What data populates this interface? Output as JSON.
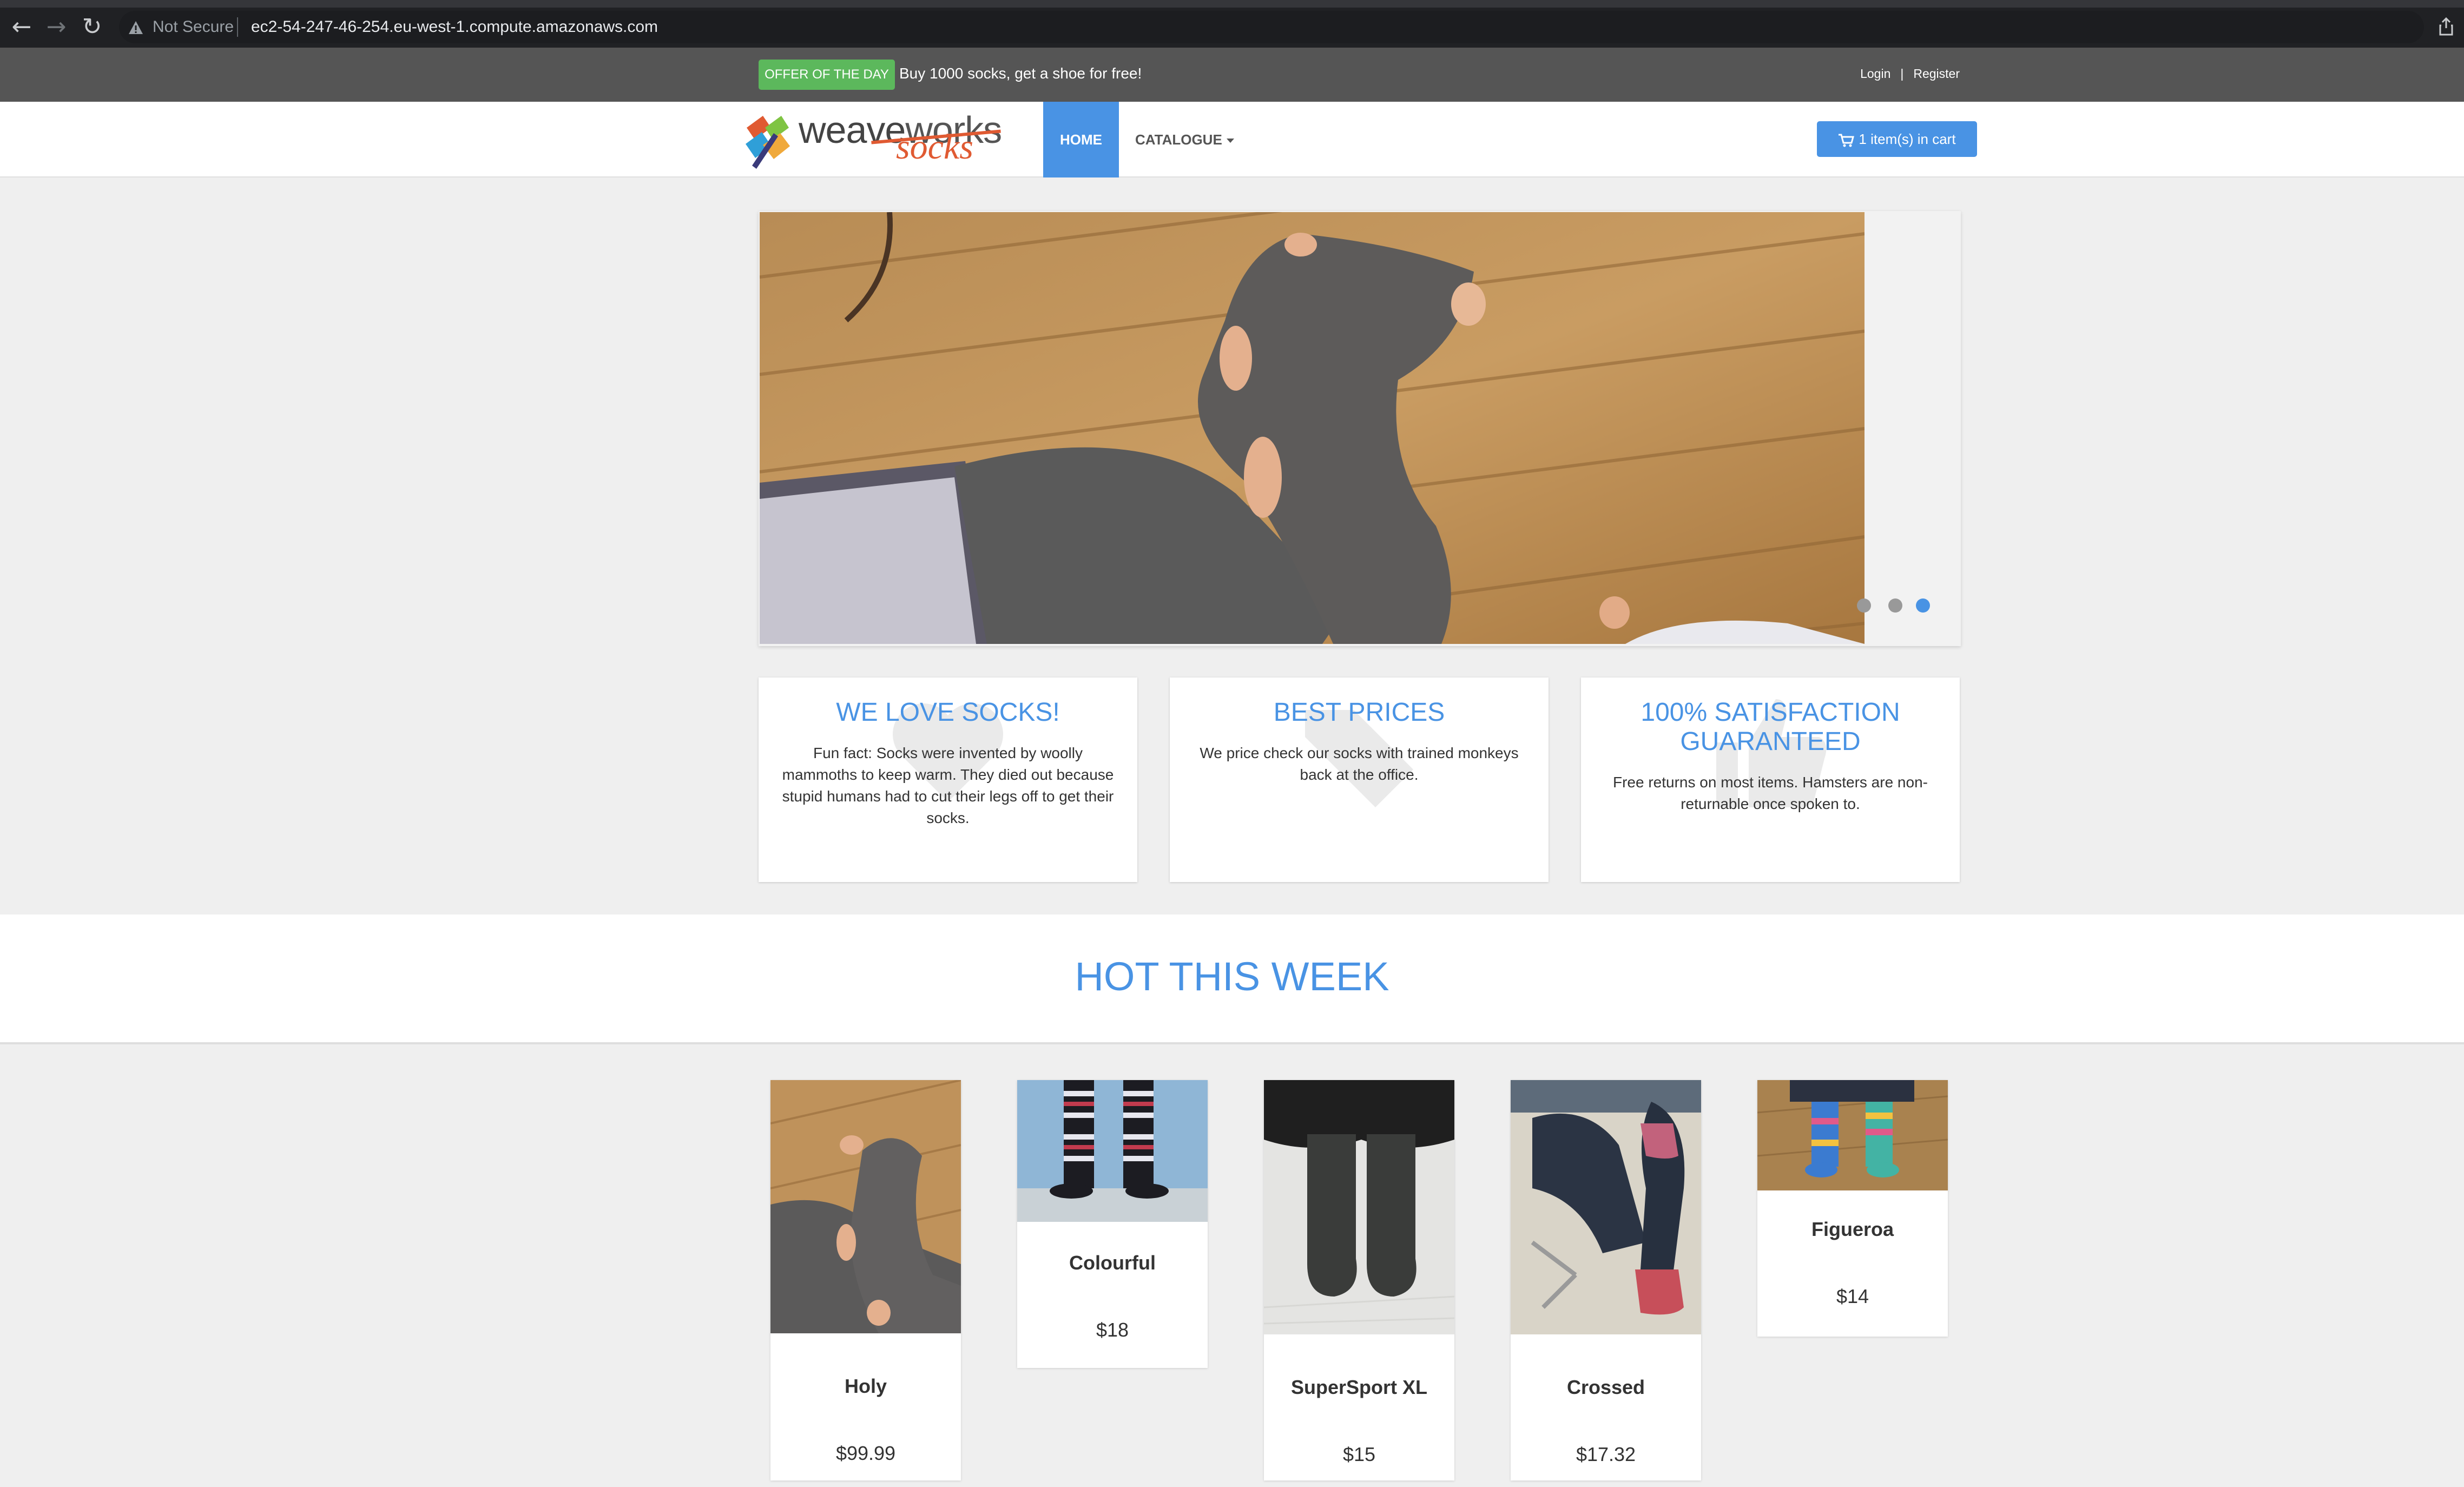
{
  "browser": {
    "security_label": "Not Secure",
    "url": "ec2-54-247-46-254.eu-west-1.compute.amazonaws.com",
    "back_icon": "←",
    "forward_icon": "→",
    "reload_icon": "↻"
  },
  "topbar": {
    "offer_badge": "OFFER OF THE DAY",
    "offer_text": "Buy 1000 socks, get a shoe for free!",
    "login": "Login",
    "separator": "|",
    "register": "Register"
  },
  "navbar": {
    "logo_word_1": "weave",
    "logo_word_2": "works",
    "logo_sub": "socks",
    "home": "HOME",
    "catalogue": "CATALOGUE",
    "cart": "1 item(s) in cart"
  },
  "carousel": {
    "slide_count": 3,
    "active_slide": 3
  },
  "features": [
    {
      "title": "WE LOVE SOCKS!",
      "text": "Fun fact: Socks were invented by woolly mammoths to keep warm. They died out because stupid humans had to cut their legs off to get their socks."
    },
    {
      "title": "BEST PRICES",
      "text": "We price check our socks with trained monkeys back at the office."
    },
    {
      "title": "100% SATISFACTION GUARANTEED",
      "text": "Free returns on most items. Hamsters are non-returnable once spoken to."
    }
  ],
  "hot": {
    "title": "HOT THIS WEEK",
    "products": [
      {
        "name": "Holy",
        "price": "$99.99"
      },
      {
        "name": "Colourful",
        "price": "$18"
      },
      {
        "name": "SuperSport XL",
        "price": "$15"
      },
      {
        "name": "Crossed",
        "price": "$17.32"
      },
      {
        "name": "Figueroa",
        "price": "$14"
      }
    ]
  },
  "colors": {
    "accent": "#4993e4",
    "offer_green": "#5cb85c",
    "topbar_gray": "#555555",
    "logo_orange": "#e05a32"
  }
}
